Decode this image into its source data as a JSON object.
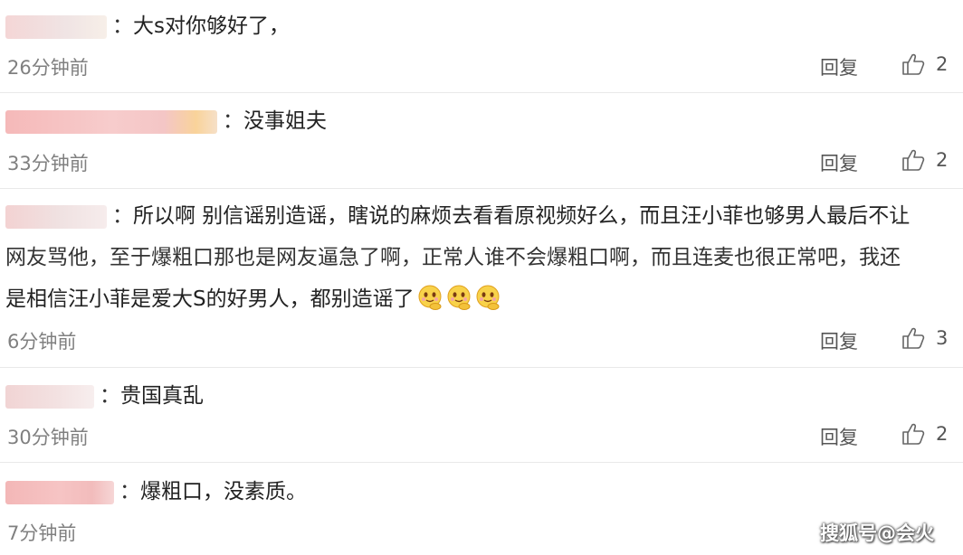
{
  "comments": [
    {
      "text": "大s对你够好了，",
      "colon": "：",
      "time": "26分钟前",
      "reply_label": "回复",
      "likes": "2"
    },
    {
      "text": "没事姐夫",
      "colon": "：",
      "time": "33分钟前",
      "reply_label": "回复",
      "likes": "2"
    },
    {
      "colon": "：",
      "line1": "所以啊 别信谣别造谣，瞎说的麻烦去看看原视频好么，而且汪小菲也够男人最后不让",
      "line2": "网友骂他，至于爆粗口那也是网友逼急了啊，正常人谁不会爆粗口啊，而且连麦也很正常吧，我还",
      "line3": "是相信汪小菲是爱大S的好男人，都别造谣了",
      "emoji_count": 3,
      "time": "6分钟前",
      "reply_label": "回复",
      "likes": "3"
    },
    {
      "text": "贵国真乱",
      "colon": "：",
      "time": "30分钟前",
      "reply_label": "回复",
      "likes": "2"
    },
    {
      "text": "爆粗口，没素质。",
      "colon": "：",
      "time": "7分钟前"
    }
  ],
  "watermark": "搜狐号@会火",
  "colors": {
    "avatar_pink": "#f5c2c2",
    "avatar_orange": "#f9d39a",
    "divider": "#e9e9e9",
    "muted_text": "#808080"
  },
  "icons": {
    "like": "thumbs-up-icon",
    "emoji": "hug-emoji-icon"
  }
}
